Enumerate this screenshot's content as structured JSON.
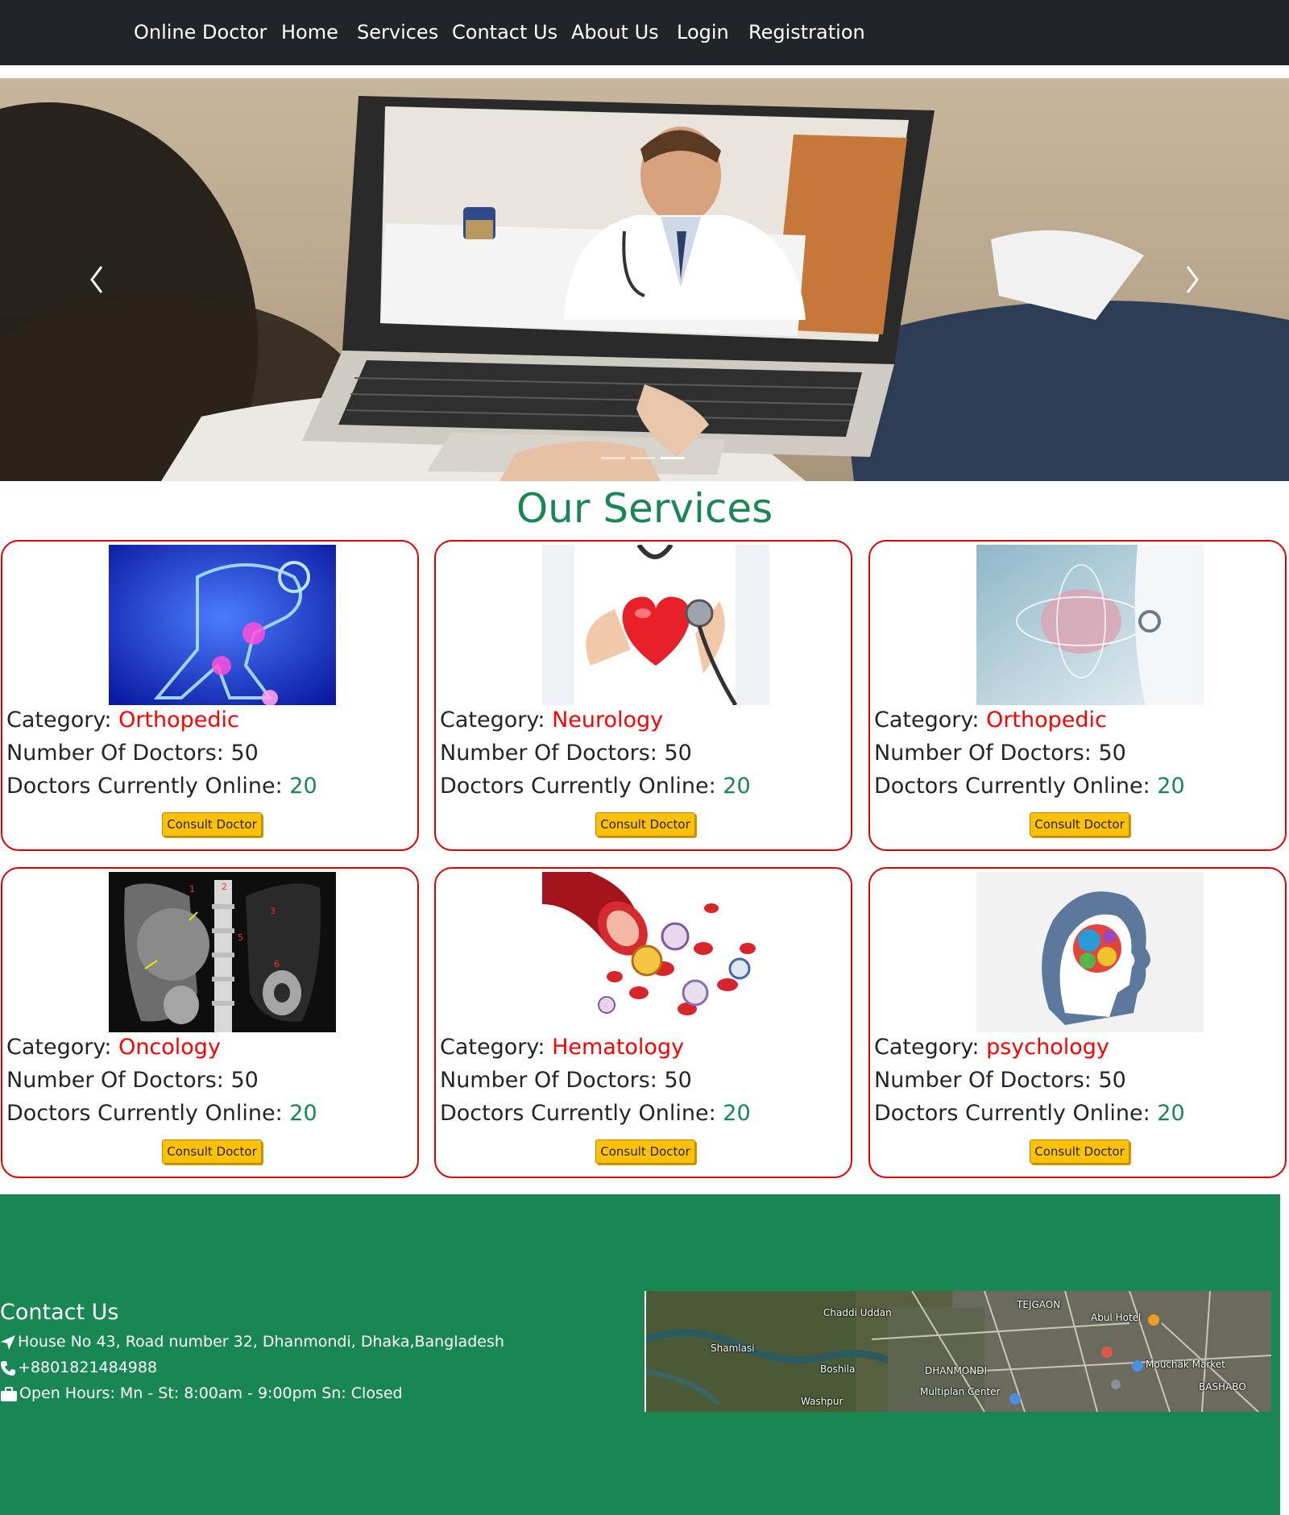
{
  "nav": {
    "brand": "Online Doctor",
    "links": [
      "Home",
      "Services",
      "Contact Us",
      "About Us",
      "Login",
      "Registration"
    ]
  },
  "carousel": {
    "slide_count": 3,
    "active_slide": 3,
    "prev_icon": "chevron-left-icon",
    "next_icon": "chevron-right-icon"
  },
  "services": {
    "title": "Our Services",
    "category_label": "Category: ",
    "doctors_label": "Number Of Doctors: ",
    "online_label": "Doctors Currently Online: ",
    "button_label": "Consult Doctor",
    "cards": [
      {
        "category": "Orthopedic",
        "doctors": "50",
        "online": "20",
        "image": "skeleton-joint-pain-image"
      },
      {
        "category": "Neurology",
        "doctors": "50",
        "online": "20",
        "image": "heart-stethoscope-image"
      },
      {
        "category": "Orthopedic",
        "doctors": "50",
        "online": "20",
        "image": "brain-doctor-image"
      },
      {
        "category": "Oncology",
        "doctors": "50",
        "online": "20",
        "image": "ct-scan-image"
      },
      {
        "category": "Hematology",
        "doctors": "50",
        "online": "20",
        "image": "blood-cells-image"
      },
      {
        "category": "psychology",
        "doctors": "50",
        "online": "20",
        "image": "colorful-mind-image"
      }
    ]
  },
  "footer": {
    "contact_title": "Contact Us",
    "address": "House No 43, Road number 32, Dhanmondi, Dhaka,Bangladesh",
    "phone": "+8801821484988",
    "hours": "Open Hours: Mn - St: 8:00am - 9:00pm Sn: Closed",
    "icons": [
      "location-arrow-icon",
      "phone-icon",
      "briefcase-icon"
    ],
    "map_labels": [
      "TEJGAON",
      "Chaddi Uddan",
      "Abul Hotel",
      "Shamlasi",
      "Mouchak Market",
      "Boshila",
      "DHANMONDI",
      "BASHABO",
      "Multiplan Center",
      "Washpur"
    ]
  },
  "colors": {
    "navbar": "#212529",
    "accent_green": "#198754",
    "card_border": "#e00000",
    "category_red": "#ff0000",
    "button_yellow": "#ffc107"
  }
}
